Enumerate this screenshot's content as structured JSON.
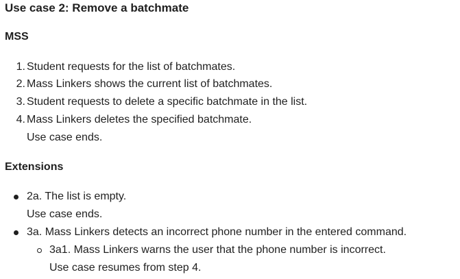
{
  "title": "Use case 2: Remove a batchmate",
  "mss": {
    "heading": "MSS",
    "steps": [
      {
        "num": "1.",
        "text": "Student requests for the list of batchmates."
      },
      {
        "num": "2.",
        "text": "Mass Linkers shows the current list of batchmates."
      },
      {
        "num": "3.",
        "text": "Student requests to delete a specific batchmate in the list."
      },
      {
        "num": "4.",
        "text": "Mass Linkers deletes the specified batchmate."
      }
    ],
    "ending": "Use case ends."
  },
  "extensions": {
    "heading": "Extensions",
    "items": [
      {
        "text": "2a. The list is empty.",
        "followup": "Use case ends."
      },
      {
        "text": "3a. Mass Linkers detects an incorrect phone number in the entered command.",
        "sub": {
          "text": "3a1. Mass Linkers warns the user that the phone number is incorrect.",
          "followup": "Use case resumes from step 4."
        }
      }
    ]
  }
}
